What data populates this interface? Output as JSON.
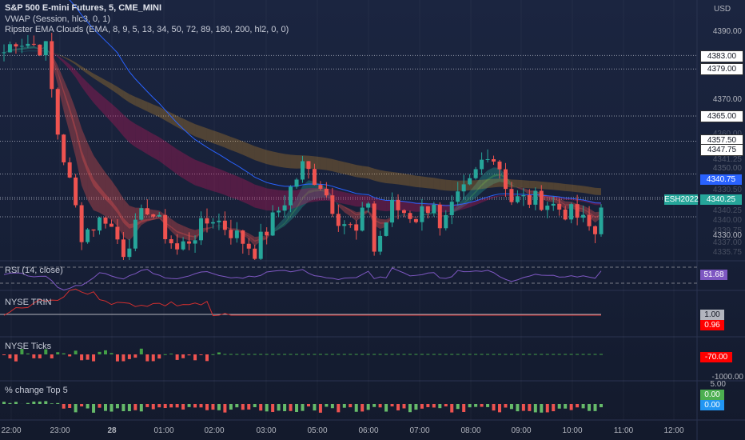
{
  "header": {
    "symbol_legend": "S&P 500 E-mini Futures, 5, CME_MINI",
    "indicators": [
      "VWAP (Session, hlc3, 0, 1)",
      "Ripster EMA Clouds (EMA, 8, 9, 5, 13, 34, 50, 72, 89, 180, 200, hl2, 0, 0)"
    ]
  },
  "price_scale": {
    "currency": "USD",
    "labels": [
      "4390.00",
      "4370.00",
      "4330.00"
    ],
    "faded_labels": [
      "4360.00",
      "4341.25",
      "4350.00",
      "4330.50",
      "4340.25",
      "4340.00",
      "4339.75",
      "4337.00",
      "4335.75"
    ],
    "level_tags": [
      "4383.00",
      "4379.00",
      "4365.00",
      "4357.50",
      "4347.75"
    ],
    "vwap_tag": "4340.75",
    "symbol_tag": "ESH2022",
    "last_price": "4340.25"
  },
  "panes": {
    "rsi": {
      "title": "RSI (14, close)",
      "value": "51.68"
    },
    "trin": {
      "title": "NYSE TRIN",
      "value_a": "1.00",
      "value_b": "0.96"
    },
    "ticks": {
      "title": "NYSE Ticks",
      "value": "-70.00",
      "scale_label": "-1000.00"
    },
    "pct": {
      "title": "% change Top 5",
      "scale_label": "5.00",
      "value_a": "0.00",
      "value_b": "0.00"
    }
  },
  "time_axis": [
    "22:00",
    "23:00",
    "28",
    "01:00",
    "02:00",
    "03:00",
    "05:00",
    "06:00",
    "07:00",
    "08:00",
    "09:00",
    "10:00",
    "11:00",
    "12:00"
  ],
  "chart_data": {
    "type": "candlestick",
    "price_path": [
      [
        0,
        4384
      ],
      [
        2,
        4388
      ],
      [
        7,
        4385
      ],
      [
        9,
        4360
      ],
      [
        11,
        4345
      ],
      [
        13,
        4330
      ],
      [
        17,
        4335
      ],
      [
        20,
        4325
      ],
      [
        24,
        4338
      ],
      [
        29,
        4325
      ],
      [
        35,
        4335
      ],
      [
        42,
        4325
      ],
      [
        47,
        4340
      ],
      [
        50,
        4350
      ],
      [
        53,
        4345
      ],
      [
        56,
        4335
      ],
      [
        59,
        4330
      ],
      [
        61,
        4340
      ],
      [
        62,
        4325
      ],
      [
        65,
        4338
      ],
      [
        69,
        4335
      ],
      [
        72,
        4340
      ],
      [
        73,
        4330
      ],
      [
        76,
        4340
      ],
      [
        78,
        4345
      ],
      [
        81,
        4355
      ],
      [
        83,
        4350
      ],
      [
        85,
        4340
      ],
      [
        90,
        4340
      ],
      [
        96,
        4335
      ],
      [
        99,
        4330
      ],
      [
        100,
        4340
      ]
    ],
    "candle_count": 101,
    "colors": {
      "up": "#26a69a",
      "down": "#ef5350",
      "vwap": "#2962ff",
      "rsi": "#7e57c2",
      "trin": "#d32f2f"
    }
  }
}
